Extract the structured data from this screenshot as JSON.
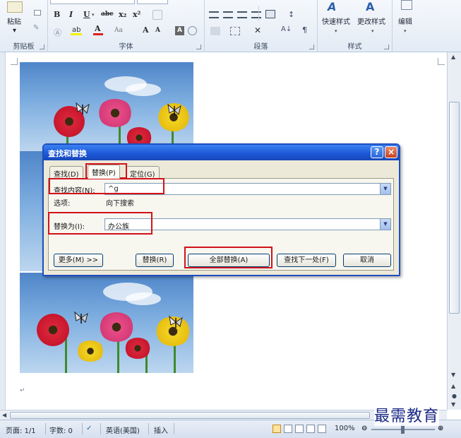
{
  "ribbon": {
    "clipboard": {
      "paste_label": "粘贴",
      "group_label": "剪贴板"
    },
    "font": {
      "group_label": "字体",
      "bold": "B",
      "italic": "I",
      "underline": "U",
      "strike": "abc",
      "subscript": "x₂",
      "superscript": "x²",
      "grow": "A",
      "shrink": "A",
      "color_a": "A",
      "aa": "Aa"
    },
    "paragraph": {
      "group_label": "段落"
    },
    "styles": {
      "group_label": "样式",
      "quick_styles": "快速样式",
      "change_styles": "更改样式"
    },
    "editing": {
      "label": "编辑"
    }
  },
  "dialog": {
    "title": "查找和替换",
    "help_glyph": "?",
    "close_glyph": "×",
    "tabs": [
      {
        "label": "查找(D)"
      },
      {
        "label": "替换(P)"
      },
      {
        "label": "定位(G)"
      }
    ],
    "find_label": "查找内容(N):",
    "find_value": "^g",
    "options_label": "选项:",
    "options_value": "向下搜索",
    "replace_label": "替换为(I):",
    "replace_value": "办公族",
    "buttons": {
      "more": "更多(M) >>",
      "replace": "替换(R)",
      "replace_all": "全部替换(A)",
      "find_next": "查找下一处(F)",
      "cancel": "取消"
    }
  },
  "status": {
    "page": "页面: 1/1",
    "words": "字数: 0",
    "language": "英语(美国)",
    "mode": "插入",
    "zoom": "100%"
  },
  "watermark": "最需教育",
  "colors": {
    "title_bar": "#1b55d6",
    "highlight_box": "#d2121a",
    "dialog_bg": "#ece9d8",
    "ribbon_bg": "#e3ebf5"
  }
}
